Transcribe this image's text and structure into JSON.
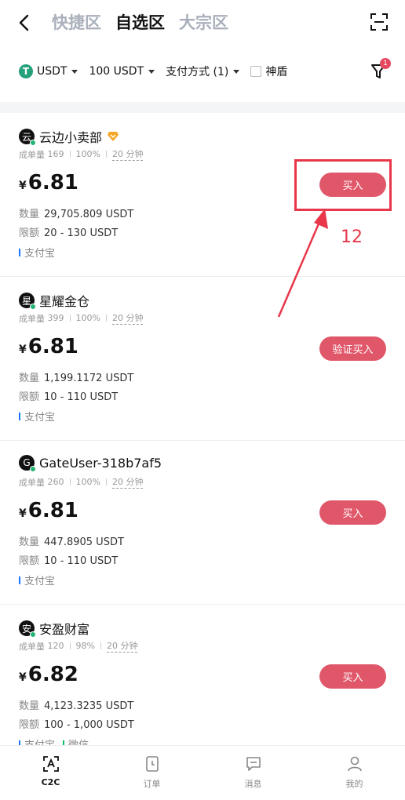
{
  "header": {
    "tabs": [
      {
        "label": "快捷区",
        "active": false
      },
      {
        "label": "自选区",
        "active": true
      },
      {
        "label": "大宗区",
        "active": false
      }
    ]
  },
  "filters": {
    "coin": "USDT",
    "coin_icon_glyph": "T",
    "amount": "100 USDT",
    "payment": "支付方式 (1)",
    "shield_label": "神盾",
    "filter_badge": "1"
  },
  "colors": {
    "accent": "#e0576a",
    "alipay": "#1677ff",
    "wechat": "#07c160",
    "annotation": "#e8364a"
  },
  "offers": [
    {
      "merchant": "云边小卖部",
      "avatar": "云",
      "verified": true,
      "orders_label": "成单量",
      "orders": "169",
      "completion": "100%",
      "time": "20 分钟",
      "currency": "¥",
      "price": "6.81",
      "qty_label": "数量",
      "qty": "29,705.809 USDT",
      "limit_label": "限额",
      "limit": "20 - 130 USDT",
      "payments": [
        "支付宝"
      ],
      "button": "买入"
    },
    {
      "merchant": "星耀金仓",
      "avatar": "星",
      "verified": false,
      "orders_label": "成单量",
      "orders": "399",
      "completion": "100%",
      "time": "20 分钟",
      "currency": "¥",
      "price": "6.81",
      "qty_label": "数量",
      "qty": "1,199.1172 USDT",
      "limit_label": "限额",
      "limit": "10 - 110 USDT",
      "payments": [
        "支付宝"
      ],
      "button": "验证买入"
    },
    {
      "merchant": "GateUser-318b7af5",
      "avatar": "G",
      "verified": false,
      "orders_label": "成单量",
      "orders": "260",
      "completion": "100%",
      "time": "20 分钟",
      "currency": "¥",
      "price": "6.81",
      "qty_label": "数量",
      "qty": "447.8905 USDT",
      "limit_label": "限额",
      "limit": "10 - 110 USDT",
      "payments": [
        "支付宝"
      ],
      "button": "买入"
    },
    {
      "merchant": "安盈财富",
      "avatar": "安",
      "verified": false,
      "orders_label": "成单量",
      "orders": "120",
      "completion": "98%",
      "time": "20 分钟",
      "currency": "¥",
      "price": "6.82",
      "qty_label": "数量",
      "qty": "4,123.3235 USDT",
      "limit_label": "限额",
      "limit": "100 - 1,000 USDT",
      "payments": [
        "支付宝",
        "微信"
      ],
      "button": "买入"
    }
  ],
  "annotation": {
    "step_number": "12"
  },
  "nav": [
    {
      "label": "C2C",
      "icon": "c2c-icon",
      "active": true
    },
    {
      "label": "订单",
      "icon": "order-icon",
      "active": false
    },
    {
      "label": "消息",
      "icon": "message-icon",
      "active": false
    },
    {
      "label": "我的",
      "icon": "profile-icon",
      "active": false
    }
  ]
}
